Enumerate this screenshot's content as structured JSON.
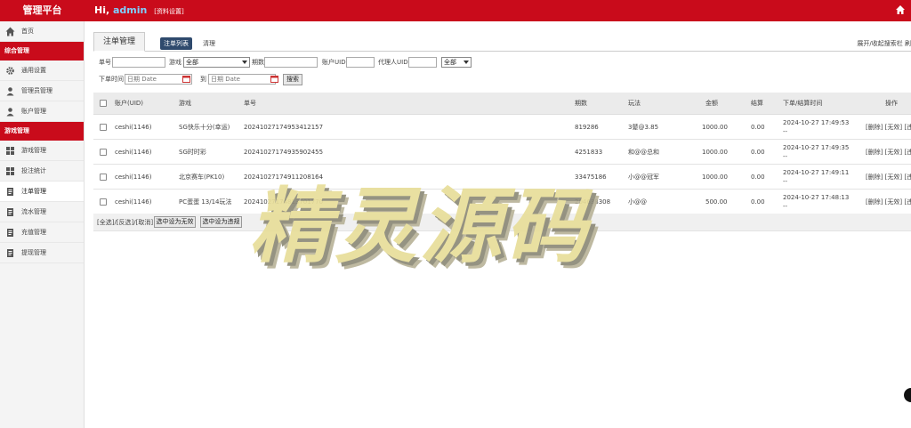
{
  "header": {
    "brand": "管理平台",
    "greeting_prefix": "Hi,",
    "user": "admin",
    "profile_link": "[资料设置]"
  },
  "sidebar": {
    "items": [
      {
        "label": "首页",
        "icon": "home-icon",
        "type": "item"
      },
      {
        "label": "综合管理",
        "type": "section"
      },
      {
        "label": "通用设置",
        "icon": "gear-icon",
        "type": "item"
      },
      {
        "label": "管理员管理",
        "icon": "user-icon",
        "type": "item"
      },
      {
        "label": "账户管理",
        "icon": "user-icon",
        "type": "item"
      },
      {
        "label": "游戏管理",
        "type": "section"
      },
      {
        "label": "游戏管理",
        "icon": "grid-icon",
        "type": "item"
      },
      {
        "label": "投注统计",
        "icon": "grid-icon",
        "type": "item"
      },
      {
        "label": "注单管理",
        "icon": "doc-icon",
        "type": "item",
        "active": true
      },
      {
        "label": "流水管理",
        "icon": "doc-icon",
        "type": "item"
      },
      {
        "label": "充值管理",
        "icon": "doc-icon",
        "type": "item"
      },
      {
        "label": "提现管理",
        "icon": "doc-icon",
        "type": "item"
      }
    ]
  },
  "tabs": {
    "main": "注单管理",
    "sub_active": "注单列表",
    "sub_other": "清理",
    "toggle": "展开/收起搜索栏  刷"
  },
  "filters": {
    "order_no_label": "单号",
    "game_label": "游戏",
    "game_value": "全部",
    "period_label": "期数",
    "account_uid_label": "账户UID",
    "agent_uid_label": "代理人UID",
    "agent_select_value": "全部",
    "time_label": "下单时间",
    "date_placeholder": "日期 Date",
    "to_label": "到",
    "search_btn": "搜索"
  },
  "table": {
    "headers": [
      "账户(UID)",
      "游戏",
      "单号",
      "期数",
      "玩法",
      "金额",
      "结算",
      "下单/结算时间",
      "操作"
    ],
    "rows": [
      {
        "account": "ceshi(1146)",
        "game": "SG快乐十分(幸运)",
        "order": "2024102717495341215​7",
        "period": "819286",
        "play": "3鼙@3.85",
        "amount": "1000.00",
        "settle": "0.00",
        "time1": "2024-10-27 17:49:53",
        "time2": "--",
        "ops": "[删除] [无效] [违规"
      },
      {
        "account": "ceshi(1146)",
        "game": "SG时时彩",
        "order": "20241027174935902455",
        "period": "4251833",
        "play": "和@@总和",
        "amount": "1000.00",
        "settle": "0.00",
        "time1": "2024-10-27 17:49:35",
        "time2": "--",
        "ops": "[删除] [无效] [违规"
      },
      {
        "account": "ceshi(1146)",
        "game": "北京赛车(PK10)",
        "order": "20241027174911208164",
        "period": "33475186",
        "play": "小@@冠军",
        "amount": "1000.00",
        "settle": "0.00",
        "time1": "2024-10-27 17:49:11",
        "time2": "--",
        "ops": "[删除] [无效] [违规"
      },
      {
        "account": "ceshi(1146)",
        "game": "PC蛋蛋 13/14玩法",
        "order": "20241027174813701770",
        "period": "204638308",
        "play": "小@@",
        "amount": "500.00",
        "settle": "0.00",
        "time1": "2024-10-27 17:48:13",
        "time2": "--",
        "ops": "[删除] [无效] [违规"
      }
    ]
  },
  "footer": {
    "select_links": "[全选]/[反选]/[取消]",
    "mark_invalid": "选中设为无效",
    "mark_violation": "选中设为违规"
  },
  "watermark": "精灵源码"
}
